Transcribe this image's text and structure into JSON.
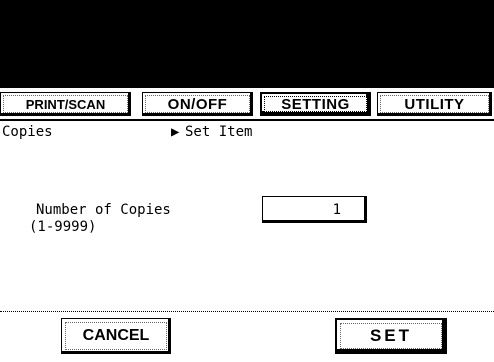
{
  "tabs": [
    {
      "label": "PRINT/SCAN",
      "active": false
    },
    {
      "label": "ON/OFF",
      "active": false
    },
    {
      "label": "SETTING",
      "active": true
    },
    {
      "label": "UTILITY",
      "active": false
    }
  ],
  "header": {
    "section": "Copies",
    "arrow_icon": "triangle-right",
    "subtitle": "Set Item"
  },
  "copies": {
    "label": "Number of Copies",
    "range": "(1-9999)",
    "value": "1"
  },
  "buttons": {
    "cancel": "CANCEL",
    "set": "SET"
  }
}
